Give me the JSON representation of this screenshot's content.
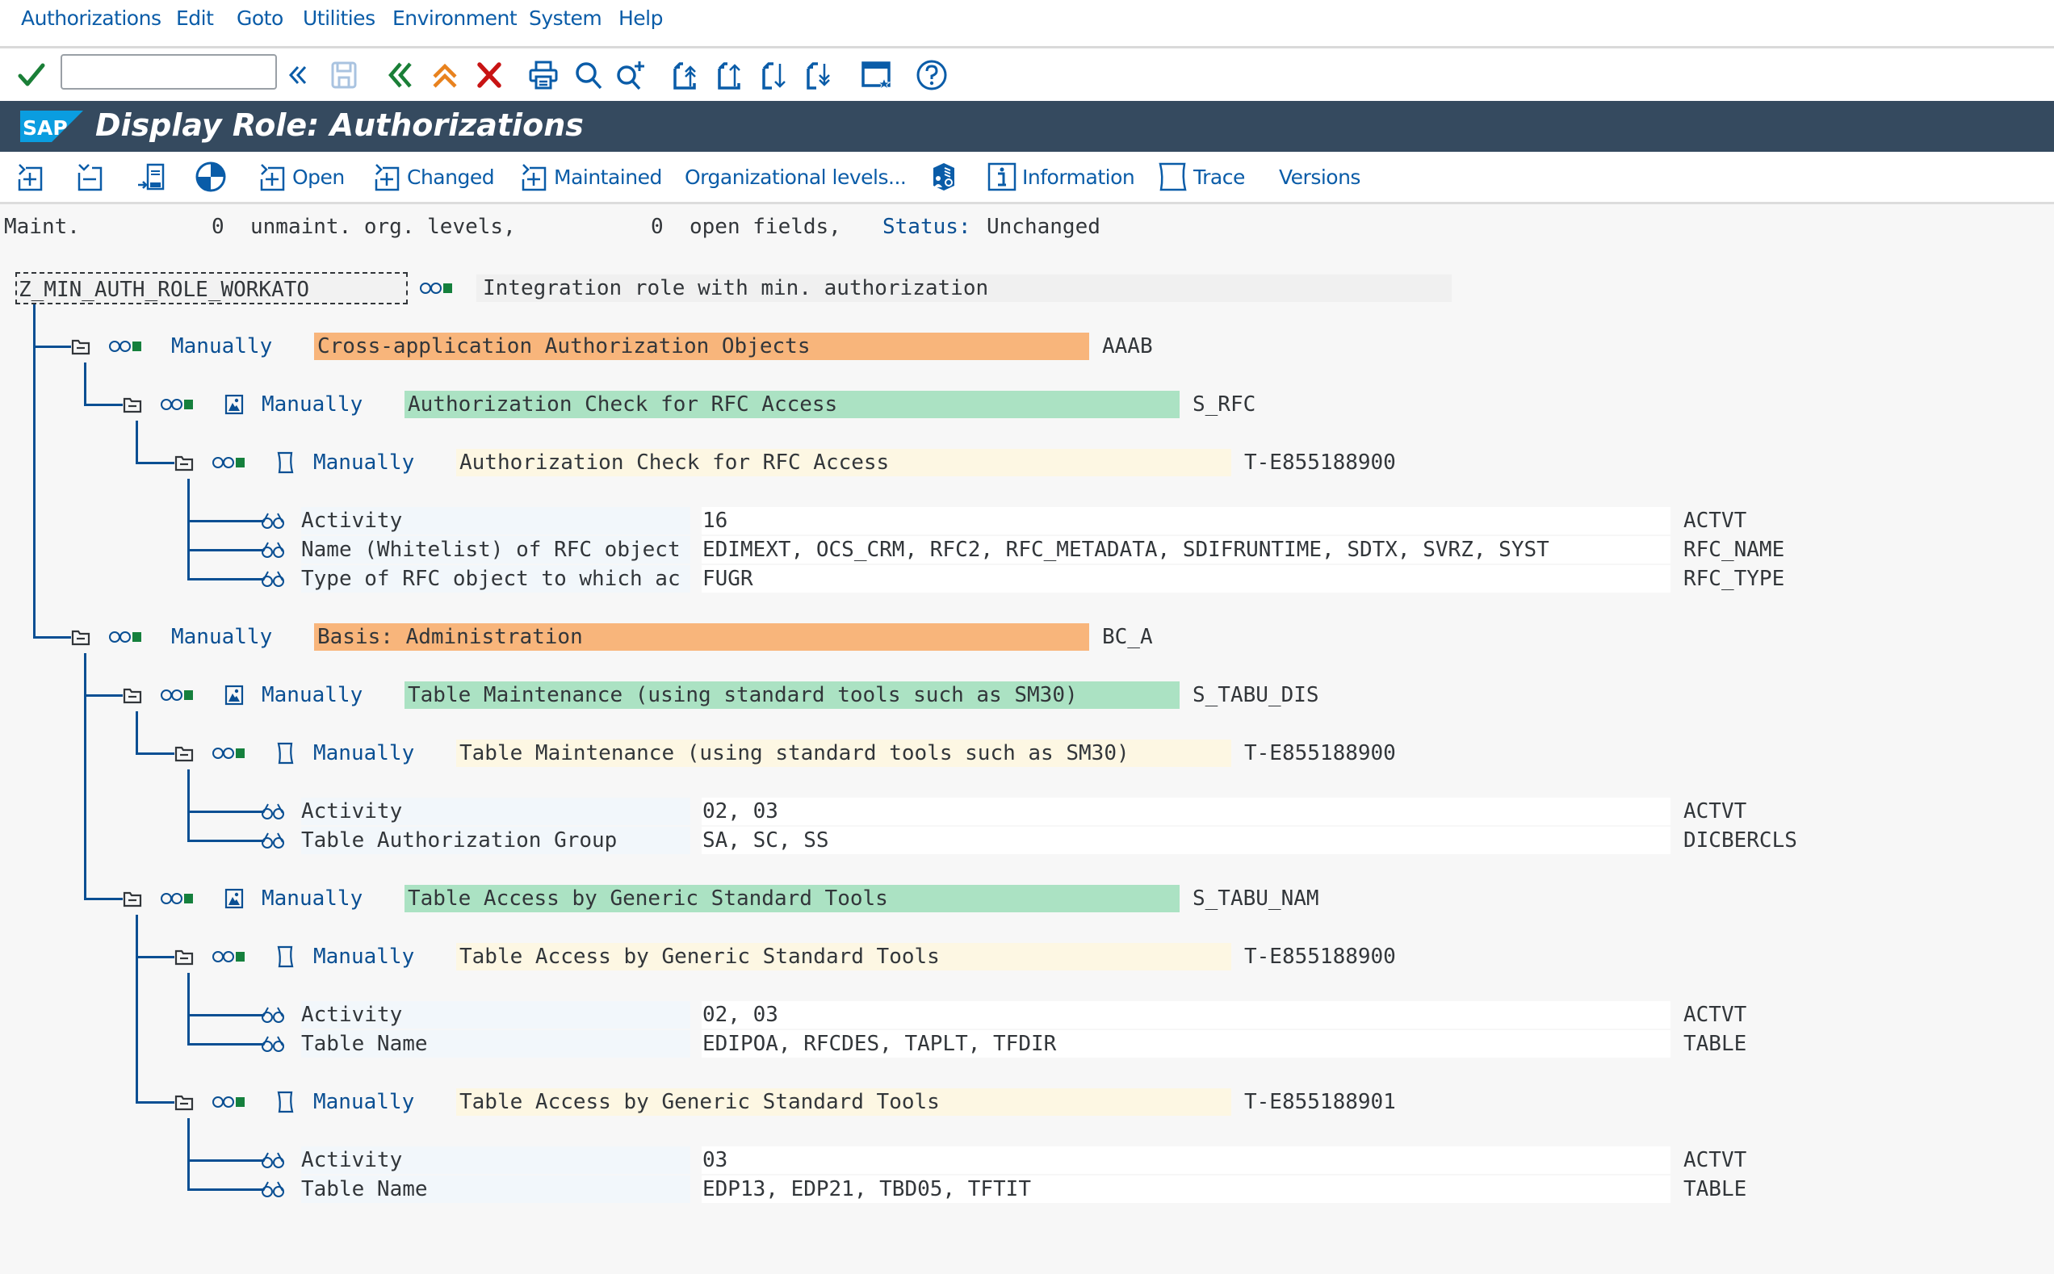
{
  "menubar": {
    "items": [
      "Authorizations",
      "Edit",
      "Goto",
      "Utilities",
      "Environment",
      "System",
      "Help"
    ]
  },
  "system_toolbar": {
    "command_field_value": "",
    "icons": [
      "enter-check-icon",
      "collapse-command-icon",
      "save-icon",
      "back-icon",
      "exit-icon",
      "cancel-icon",
      "print-icon",
      "find-icon",
      "find-next-icon",
      "first-page-icon",
      "previous-page-icon",
      "next-page-icon",
      "last-page-icon",
      "customize-layout-icon",
      "help-icon"
    ]
  },
  "title_bar": {
    "logo": "SAP",
    "title": "Display Role: Authorizations"
  },
  "app_toolbar": {
    "buttons": [
      {
        "icon": "expand-all-icon",
        "label": ""
      },
      {
        "icon": "collapse-all-icon",
        "label": ""
      },
      {
        "icon": "change-doc-icon",
        "label": ""
      },
      {
        "icon": "status-pie-icon",
        "label": ""
      },
      {
        "icon": "expand-icon",
        "label": "Open"
      },
      {
        "icon": "expand-icon",
        "label": "Changed"
      },
      {
        "icon": "expand-icon",
        "label": "Maintained"
      },
      {
        "icon": "",
        "label": "Organizational levels..."
      },
      {
        "icon": "user-menu-icon",
        "label": ""
      },
      {
        "icon": "information-icon",
        "label": "Information"
      },
      {
        "icon": "trace-icon",
        "label": "Trace"
      },
      {
        "icon": "",
        "label": "Versions"
      }
    ]
  },
  "status_line": {
    "maint_label": "Maint.",
    "unmaint_count": "0",
    "unmaint_label": "unmaint. org. levels,",
    "open_count": "0",
    "open_label": "open fields,",
    "status_label": "Status:",
    "status_value": "Unchanged"
  },
  "tree": {
    "root": {
      "name": "Z_MIN_AUTH_ROLE_WORKATO",
      "description": "Integration role with min. authorization"
    },
    "classes": [
      {
        "status": "Manually",
        "text": "Cross-application Authorization Objects",
        "code": "AAAB",
        "objects": [
          {
            "status": "Manually",
            "text": "Authorization Check for RFC Access",
            "code": "S_RFC",
            "authorizations": [
              {
                "status": "Manually",
                "text": "Authorization Check for RFC Access",
                "code": "T-E855188900",
                "fields": [
                  {
                    "label": "Activity",
                    "value": "16",
                    "tech": "ACTVT"
                  },
                  {
                    "label": "Name (Whitelist) of RFC object",
                    "value": "EDIMEXT, OCS_CRM, RFC2, RFC_METADATA, SDIFRUNTIME, SDTX, SVRZ, SYST",
                    "tech": "RFC_NAME"
                  },
                  {
                    "label": "Type of RFC object to which ac",
                    "value": "FUGR",
                    "tech": "RFC_TYPE"
                  }
                ]
              }
            ]
          }
        ]
      },
      {
        "status": "Manually",
        "text": "Basis: Administration",
        "code": "BC_A",
        "objects": [
          {
            "status": "Manually",
            "text": "Table Maintenance (using standard tools such as SM30)",
            "code": "S_TABU_DIS",
            "authorizations": [
              {
                "status": "Manually",
                "text": "Table Maintenance (using standard tools such as SM30)",
                "code": "T-E855188900",
                "fields": [
                  {
                    "label": "Activity",
                    "value": "02, 03",
                    "tech": "ACTVT"
                  },
                  {
                    "label": "Table Authorization Group",
                    "value": "SA, SC, SS",
                    "tech": "DICBERCLS"
                  }
                ]
              }
            ]
          },
          {
            "status": "Manually",
            "text": "Table Access by Generic Standard Tools",
            "code": "S_TABU_NAM",
            "authorizations": [
              {
                "status": "Manually",
                "text": "Table Access by Generic Standard Tools",
                "code": "T-E855188900",
                "fields": [
                  {
                    "label": "Activity",
                    "value": "02, 03",
                    "tech": "ACTVT"
                  },
                  {
                    "label": "Table Name",
                    "value": "EDIPOA, RFCDES, TAPLT, TFDIR",
                    "tech": "TABLE"
                  }
                ]
              },
              {
                "status": "Manually",
                "text": "Table Access by Generic Standard Tools",
                "code": "T-E855188901",
                "fields": [
                  {
                    "label": "Activity",
                    "value": "03",
                    "tech": "ACTVT"
                  },
                  {
                    "label": "Table Name",
                    "value": "EDP13, EDP21, TBD05, TFTIT",
                    "tech": "TABLE"
                  }
                ]
              }
            ]
          }
        ]
      }
    ]
  },
  "colors": {
    "title_bar": "#354a5f",
    "link_blue": "#0a5ca8",
    "class_highlight": "#f8b57b",
    "object_highlight": "#abe2c3",
    "authorization_highlight": "#fdf7e3",
    "traffic_green": "#15803d"
  }
}
